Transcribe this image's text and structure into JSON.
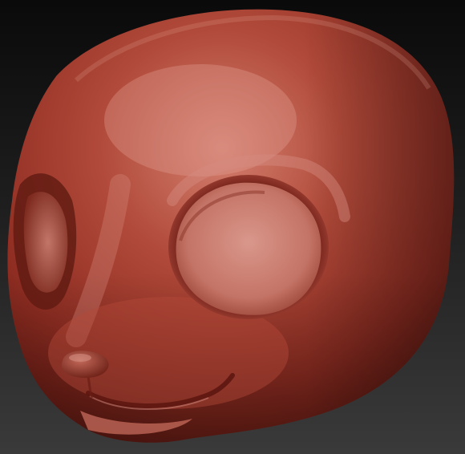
{
  "viewport": {
    "background_top": "#0a0a0a",
    "background_bottom": "#3a3a3a",
    "material_color": "#a63a2c",
    "material_highlight": "#d98a7c",
    "material_shadow": "#5a150f",
    "model": "sculpted-creature-head"
  }
}
